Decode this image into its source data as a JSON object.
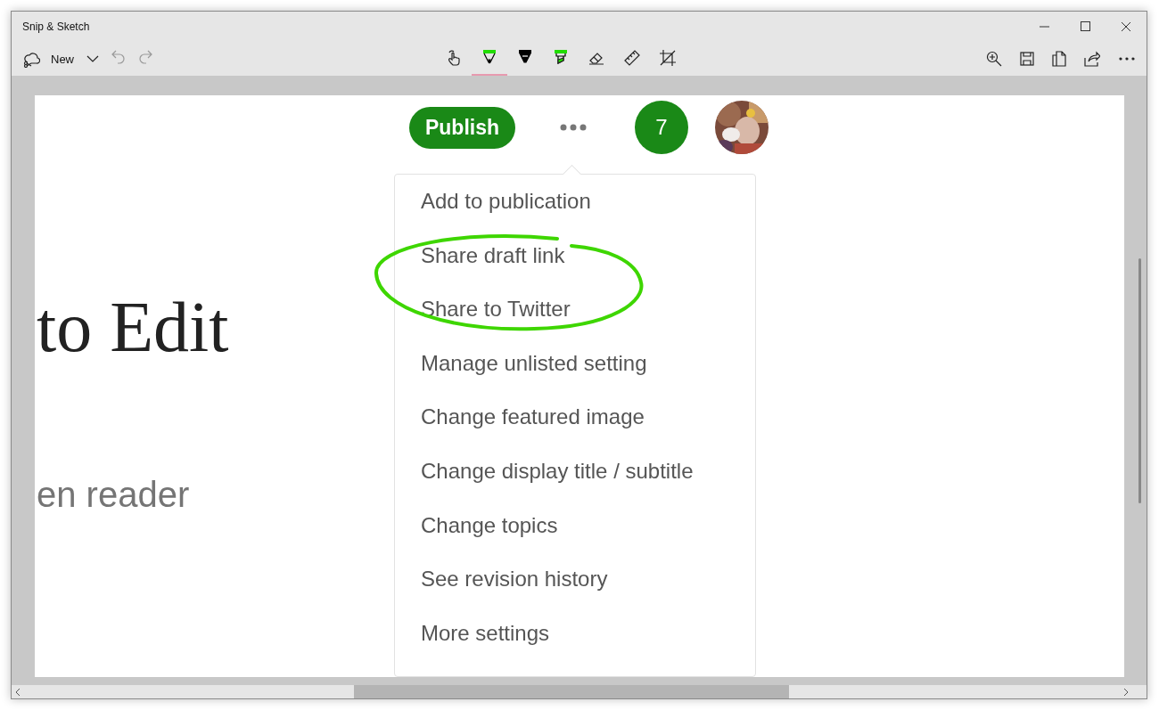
{
  "window": {
    "title": "Snip & Sketch"
  },
  "toolbar": {
    "new_label": "New",
    "tools": [
      {
        "kind": "touch",
        "selected": false
      },
      {
        "kind": "ballpoint",
        "selected": true,
        "color": "#22dd00"
      },
      {
        "kind": "pencil",
        "selected": false,
        "color": "#000000"
      },
      {
        "kind": "highlighter",
        "selected": false,
        "color": "#22dd00"
      },
      {
        "kind": "eraser",
        "selected": false
      },
      {
        "kind": "ruler",
        "selected": false
      },
      {
        "kind": "crop",
        "selected": false
      }
    ]
  },
  "page": {
    "heading": "to Edit",
    "subheading": "en reader",
    "header": {
      "publish": "Publish",
      "notifications": "7"
    },
    "menu": {
      "items": [
        "Add to publication",
        "Share draft link",
        "Share to Twitter",
        "Manage unlisted setting",
        "Change featured image",
        "Change display title / subtitle",
        "Change topics",
        "See revision history",
        "More settings"
      ]
    }
  }
}
